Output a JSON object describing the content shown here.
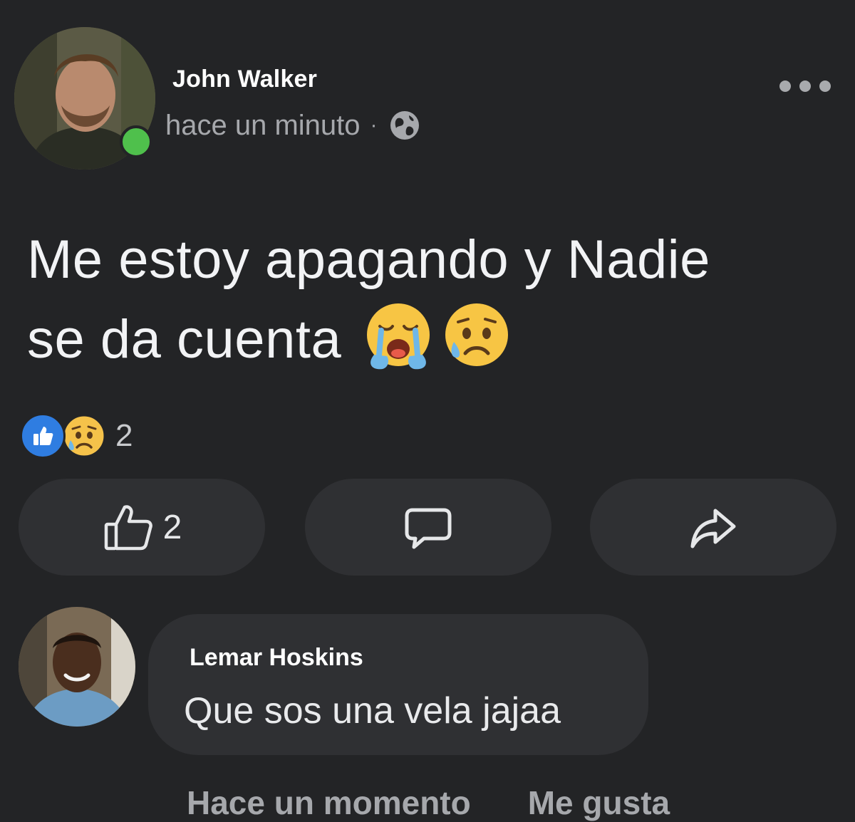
{
  "post": {
    "author": "John Walker",
    "timestamp": "hace un minuto",
    "separator": "·",
    "privacy_icon": "globe-icon",
    "text_line_1": "Me estoy apagando y Nadie",
    "text_line_2": "se da cuenta",
    "emojis": [
      "loudly-crying-face",
      "sad-but-relieved-face"
    ]
  },
  "reactions": {
    "types": [
      "like",
      "sad"
    ],
    "count": "2"
  },
  "actions": {
    "like_count": "2",
    "like_icon": "thumbs-up-icon",
    "comment_icon": "comment-icon",
    "share_icon": "share-icon"
  },
  "comment": {
    "author": "Lemar Hoskins",
    "text": "Que sos una vela jajaa",
    "time": "Hace un momento",
    "like_label": "Me gusta"
  },
  "colors": {
    "background": "#232426",
    "button": "#2f3033",
    "online": "#4fc04c",
    "like_blue": "#2f7de1"
  }
}
